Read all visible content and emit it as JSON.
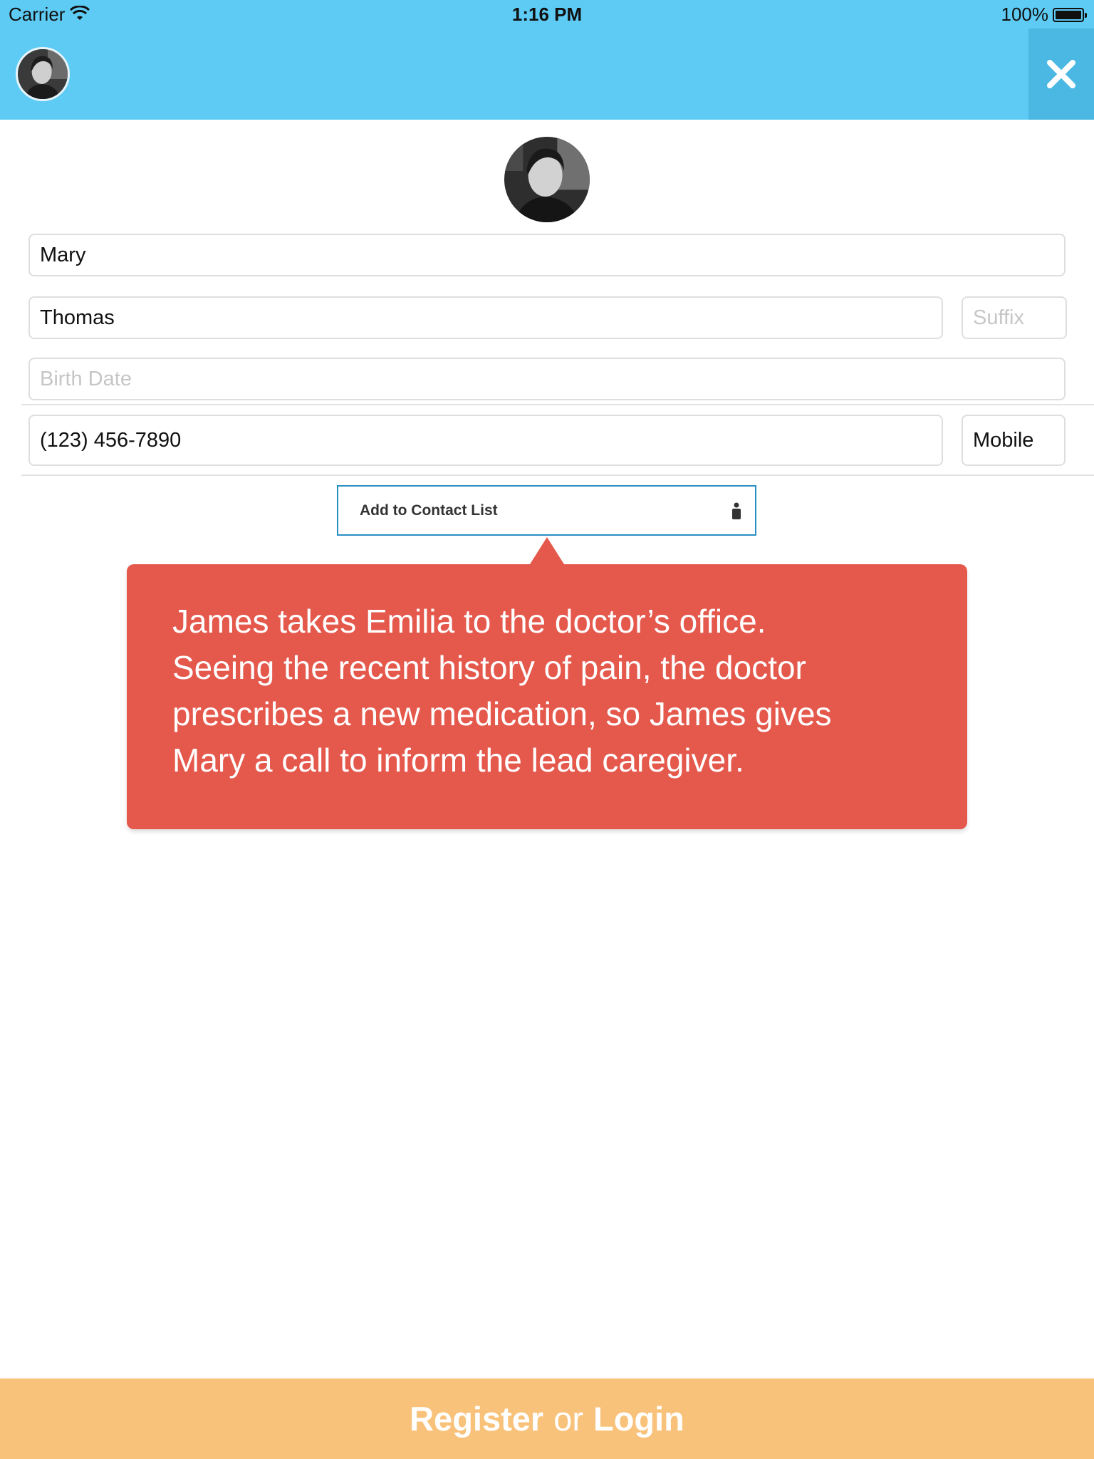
{
  "status_bar": {
    "carrier": "Carrier",
    "time": "1:16 PM",
    "battery": "100%"
  },
  "nav": {
    "avatar_icon": "user-avatar",
    "close_icon": "close-icon"
  },
  "form": {
    "first_name": "Mary",
    "last_name": "Thomas",
    "suffix_placeholder": "Suffix",
    "birth_date_placeholder": "Birth Date",
    "phone": "(123) 456-7890",
    "phone_type": "Mobile",
    "add_contact_label": "Add to Contact List",
    "add_contact_icon": "person-icon"
  },
  "callout": {
    "text_line1": "James takes Emilia to the doctor’s office.",
    "text_line2": "Seeing the recent history of pain, the doctor",
    "text_line3": "prescribes a new medication, so James gives",
    "text_line4": "Mary a call to inform the lead caregiver."
  },
  "bottom_bar": {
    "register_label": "Register",
    "or_label": "or",
    "login_label": "Login"
  },
  "colors": {
    "header_blue": "#5ecbf5",
    "close_blue": "#4ab8e3",
    "callout_red": "#e5584c",
    "bottom_orange": "#f8c27a",
    "button_border": "#2b8fc4"
  }
}
